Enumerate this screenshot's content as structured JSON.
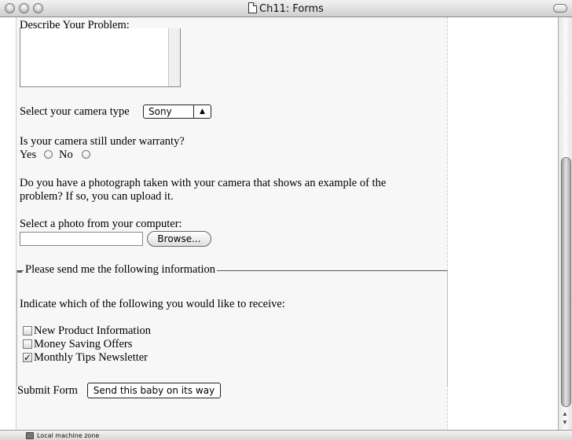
{
  "window": {
    "title": "Ch11: Forms"
  },
  "form": {
    "describe_label": "Describe Your Problem:",
    "camera_label": "Select your camera type",
    "camera_value": "Sony",
    "warranty_question": "Is your camera still under warranty?",
    "yes_label": "Yes",
    "no_label": "No",
    "photo_question_line1": "Do you have a photograph taken with your camera that shows an example of the",
    "photo_question_line2": "problem? If so, you can upload it.",
    "select_photo_label": "Select a photo from your computer:",
    "browse_label": "Browse...",
    "fieldset_legend": "Please send me the following information",
    "receive_label": "Indicate which of the following you would like to receive:",
    "checkboxes": [
      {
        "label": "New Product Information",
        "checked": false
      },
      {
        "label": "Money Saving Offers",
        "checked": false
      },
      {
        "label": "Monthly Tips Newsletter",
        "checked": true
      }
    ],
    "submit_label": "Submit Form",
    "submit_button": "Send this baby on its way"
  },
  "status": {
    "zone": "Local machine zone"
  }
}
